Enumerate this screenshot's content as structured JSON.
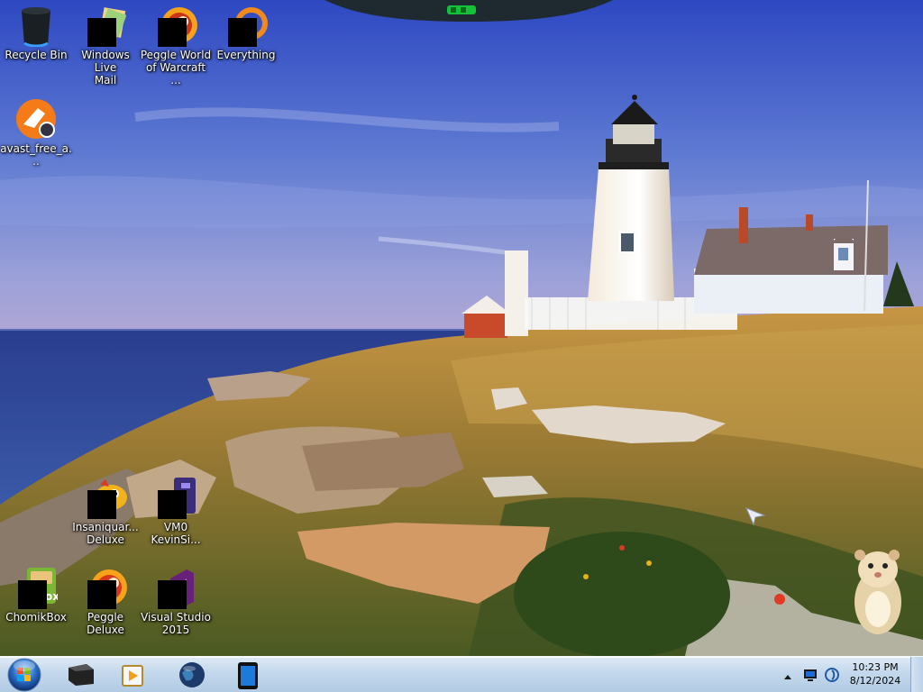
{
  "desktop": {
    "icons": [
      {
        "label": "Recycle Bin",
        "icon": "recycle-bin-icon"
      },
      {
        "label": "Windows Live\nMail",
        "icon": "mail-icon"
      },
      {
        "label": "Peggle World\nof Warcraft ...",
        "icon": "peggle-wow-icon"
      },
      {
        "label": "Everything",
        "icon": "search-ring-icon"
      },
      {
        "label": "avast_free_a...",
        "icon": "avast-icon"
      },
      {
        "label": "Insaniquar...\nDeluxe",
        "icon": "insaniquarium-icon"
      },
      {
        "label": "VM0\nKevinSi...",
        "icon": "vm-icon"
      },
      {
        "label": "ChomikBox",
        "icon": "chomikbox-icon"
      },
      {
        "label": "Peggle Deluxe",
        "icon": "peggle-icon"
      },
      {
        "label": "Visual Studio\n2015",
        "icon": "visual-studio-icon"
      }
    ]
  },
  "taskbar": {
    "pinned": [
      {
        "name": "start",
        "icon": "windows-orb-icon"
      },
      {
        "name": "pinned-1",
        "icon": "dark-box-icon"
      },
      {
        "name": "pinned-2",
        "icon": "media-player-icon"
      },
      {
        "name": "pinned-3",
        "icon": "globe-icon"
      },
      {
        "name": "pinned-4",
        "icon": "tablet-icon"
      }
    ],
    "clock": {
      "time": "10:23 PM",
      "date": "8/12/2024"
    }
  },
  "colors": {
    "sky_top": "#3a54c8",
    "sky_mid": "#6f8ad8",
    "sky_horizon": "#9da5d8",
    "sea": "#2c3f8c",
    "grass": "#b98a3c",
    "taskbar": "#c4d8ec"
  }
}
